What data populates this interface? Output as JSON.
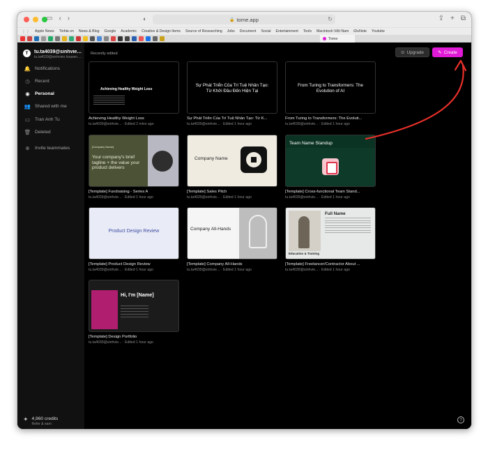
{
  "browser": {
    "url": "tome.app",
    "bookmarks": [
      "Apple News",
      "Tinhte.vn",
      "News & Blog",
      "Google",
      "Academic",
      "Creative & Design Items",
      "Source of Researching",
      "Jobs",
      "Document",
      "Social",
      "Entertainment",
      "Tools",
      "Macintosh Việt Nam",
      "iDuNote",
      "Youtube"
    ],
    "active_tab": "Tome"
  },
  "user": {
    "initial": "T",
    "name": "tu.ta4039@sinhvien.hoasen.edu.vn",
    "email": "tu.ta4039@sinhvien.hoasen.edu.vn"
  },
  "nav": {
    "notifications": "Notifications",
    "recent": "Recent",
    "personal": "Personal",
    "shared": "Shared with me",
    "person": "Tran Anh Tu",
    "deleted": "Deleted",
    "invite": "Invite teammates"
  },
  "credits": {
    "amount": "4,960 credits",
    "sub": "Refer & earn"
  },
  "main": {
    "section_title": "Recently edited",
    "upgrade_label": "Upgrade",
    "create_label": "Create"
  },
  "cards": [
    {
      "title": "Achieving Healthy Weight Loss",
      "meta": "tu.ta4039@sinhvie... · Edited 2 mins ago",
      "thumb_text": "Achieving Healthy Weight Loss"
    },
    {
      "title": "Sự Phát Triển Của Trí Tuệ Nhân Tạo: Từ K...",
      "meta": "tu.ta4039@sinhvie... · Edited 1 hour ago",
      "thumb_text": "Sự Phát Triển Của Trí Tuệ Nhân Tạo: Từ Khởi Đầu Đến Hiện Tại"
    },
    {
      "title": "From Turing to Transformers: The Evoluti...",
      "meta": "tu.ta4039@sinhvie... · Edited 1 hour ago",
      "thumb_text": "From Turing to Transformers: The Evolution of AI"
    },
    {
      "title": "[Template] Fundraising - Series A",
      "meta": "tu.ta4039@sinhvie... · Edited 1 hour ago",
      "thumb_label": "[Company Name]",
      "thumb_text": "Your company's brief tagline + the value your product delivers"
    },
    {
      "title": "[Template] Sales Pitch",
      "meta": "tu.ta4039@sinhvie... · Edited 1 hour ago",
      "thumb_text": "Company Name"
    },
    {
      "title": "[Template] Cross-functional Team Stand...",
      "meta": "tu.ta4039@sinhvie... · Edited 1 hour ago",
      "thumb_text": "Team Name Standup"
    },
    {
      "title": "[Template] Product Design Review",
      "meta": "tu.ta4039@sinhvie... · Edited 1 hour ago",
      "thumb_text": "Product Design Review"
    },
    {
      "title": "[Template] Company All-Hands",
      "meta": "tu.ta4039@sinhvie... · Edited 1 hour ago",
      "thumb_text": "Company All-Hands"
    },
    {
      "title": "[Template] Freelancer/Contractor About ...",
      "meta": "tu.ta4039@sinhvie... · Edited 1 hour ago",
      "thumb_text": "Full Name",
      "thumb_sub": "Education & Training"
    },
    {
      "title": "[Template] Design Portfolio",
      "meta": "tu.ta4039@sinhvie... · Edited 1 hour ago",
      "thumb_text": "Hi, I'm [Name]"
    }
  ],
  "colors": {
    "accent": "#e01ad6",
    "annotation": "#e8302a"
  }
}
